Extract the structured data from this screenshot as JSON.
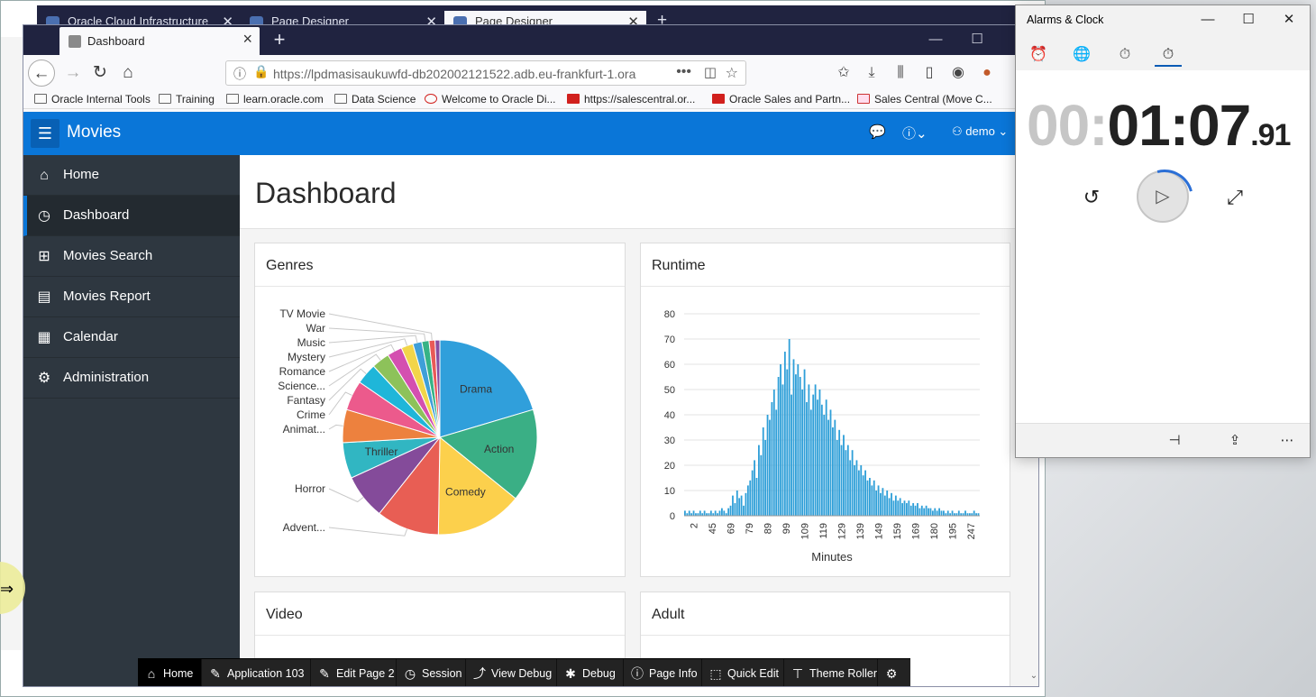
{
  "bg_browser": {
    "tabs": [
      {
        "label": "Oracle Cloud Infrastructure"
      },
      {
        "label": "Page Designer"
      },
      {
        "label": "Page Designer"
      }
    ]
  },
  "browser": {
    "tab_title": "Dashboard",
    "url": "https://lpdmasisaukuwfd-db202002121522.adb.eu-frankfurt-1.ora",
    "bookmarks": [
      "Oracle Internal Tools",
      "Training",
      "learn.oracle.com",
      "Data Science",
      "Welcome to Oracle Di...",
      "https://salescentral.or...",
      "Oracle Sales and Partn...",
      "Sales Central (Move C..."
    ]
  },
  "app": {
    "name": "Movies",
    "user": "demo",
    "nav": [
      "Home",
      "Dashboard",
      "Movies Search",
      "Movies Report",
      "Calendar",
      "Administration"
    ],
    "current_nav": "Dashboard",
    "page_title": "Dashboard"
  },
  "cards": {
    "genres": "Genres",
    "runtime": "Runtime",
    "video": "Video",
    "adult": "Adult"
  },
  "chart_data": [
    {
      "type": "pie",
      "title": "Genres",
      "slices": [
        {
          "label": "Drama",
          "value": 20.5,
          "color": "#309fdb"
        },
        {
          "label": "Action",
          "value": 15.5,
          "color": "#3aaf85"
        },
        {
          "label": "Comedy",
          "value": 14.5,
          "color": "#fcd04c"
        },
        {
          "label": "Advent...",
          "value": 10.5,
          "color": "#e85e54"
        },
        {
          "label": "Horror",
          "value": 7.5,
          "color": "#844b9a"
        },
        {
          "label": "Thriller",
          "value": 6,
          "color": "#31b6c2"
        },
        {
          "label": "Animat...",
          "value": 5.5,
          "color": "#ed813e"
        },
        {
          "label": "Crime",
          "value": 5,
          "color": "#ec5a8c"
        },
        {
          "label": "Fantasy",
          "value": 3.5,
          "color": "#1fb6d9"
        },
        {
          "label": "Science...",
          "value": 3,
          "color": "#8dc25a"
        },
        {
          "label": "Romance",
          "value": 2.5,
          "color": "#d44fb0"
        },
        {
          "label": "Mystery",
          "value": 2,
          "color": "#f2d54a"
        },
        {
          "label": "Music",
          "value": 1.5,
          "color": "#3f9fd8"
        },
        {
          "label": "War",
          "value": 1.2,
          "color": "#36b386"
        },
        {
          "label": "TV Movie",
          "value": 1,
          "color": "#e95a57"
        },
        {
          "label": "",
          "value": 0.8,
          "color": "#8a4ca0"
        }
      ],
      "inner_labels": [
        "Drama",
        "Action",
        "Comedy",
        "Thriller"
      ]
    },
    {
      "type": "bar",
      "title": "Runtime",
      "xlabel": "Minutes",
      "ylabel": "",
      "ylim": [
        0,
        80
      ],
      "yticks": [
        0,
        10,
        20,
        30,
        40,
        50,
        60,
        70,
        80
      ],
      "xticks": [
        "2",
        "45",
        "69",
        "79",
        "89",
        "99",
        "109",
        "119",
        "129",
        "139",
        "149",
        "159",
        "169",
        "180",
        "195",
        "247"
      ],
      "color": "#2f9fd8",
      "values": [
        2,
        1,
        2,
        1,
        2,
        1,
        1,
        2,
        1,
        2,
        1,
        1,
        2,
        1,
        2,
        1,
        2,
        3,
        2,
        1,
        3,
        4,
        8,
        5,
        10,
        7,
        8,
        4,
        9,
        12,
        14,
        18,
        22,
        15,
        28,
        24,
        35,
        30,
        40,
        38,
        45,
        50,
        42,
        55,
        60,
        52,
        65,
        58,
        70,
        48,
        62,
        56,
        60,
        55,
        50,
        58,
        45,
        52,
        42,
        48,
        52,
        46,
        50,
        44,
        40,
        46,
        38,
        42,
        35,
        38,
        30,
        34,
        28,
        32,
        26,
        28,
        22,
        26,
        20,
        22,
        18,
        20,
        16,
        18,
        14,
        15,
        12,
        14,
        10,
        12,
        9,
        11,
        8,
        10,
        7,
        9,
        6,
        8,
        6,
        7,
        5,
        6,
        5,
        6,
        4,
        5,
        4,
        5,
        3,
        4,
        3,
        4,
        3,
        3,
        2,
        3,
        2,
        3,
        2,
        2,
        1,
        2,
        1,
        2,
        1,
        1,
        2,
        1,
        1,
        2,
        1,
        1,
        1,
        2,
        1,
        1
      ]
    }
  ],
  "devbar": [
    "Home",
    "Application 103",
    "Edit Page 2",
    "Session",
    "View Debug",
    "Debug",
    "Page Info",
    "Quick Edit",
    "Theme Roller"
  ],
  "alarms": {
    "title": "Alarms & Clock",
    "timer_dim": "00:",
    "timer_main": "01:07",
    "timer_ms": ".91"
  },
  "colors": {
    "header": "#0a76d8",
    "sidebar": "#2e3740",
    "devbar": "#232323"
  }
}
